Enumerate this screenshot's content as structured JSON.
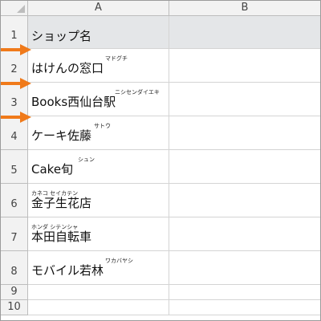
{
  "columns": [
    "A",
    "B"
  ],
  "rows": [
    {
      "num": "1",
      "text": "ショップ名",
      "furigana": "",
      "header": true,
      "arrow": false
    },
    {
      "num": "2",
      "text": "はけんの窓口",
      "furigana": "マドグチ",
      "header": false,
      "arrow": true
    },
    {
      "num": "3",
      "text": "Books西仙台駅",
      "furigana": "ニシセンダイエキ",
      "header": false,
      "arrow": true
    },
    {
      "num": "4",
      "text": "ケーキ佐藤",
      "furigana": "サトウ",
      "header": false,
      "arrow": true
    },
    {
      "num": "5",
      "text": "Cake旬",
      "furigana": "シュン",
      "header": false,
      "arrow": false
    },
    {
      "num": "6",
      "text": "金子生花店",
      "furigana": "カネコ セイカテン",
      "header": false,
      "arrow": false
    },
    {
      "num": "7",
      "text": "本田自転車",
      "furigana": "ホンダ シテンシャ",
      "header": false,
      "arrow": false
    },
    {
      "num": "8",
      "text": "モバイル若林",
      "furigana": "ワカバヤシ",
      "header": false,
      "arrow": false
    },
    {
      "num": "9",
      "text": "",
      "furigana": "",
      "header": false,
      "arrow": false
    },
    {
      "num": "10",
      "text": "",
      "furigana": "",
      "header": false,
      "arrow": false
    }
  ],
  "colors": {
    "arrow": "#f07a1a",
    "header_row": "#e4e6e8",
    "gridline": "#d4d4d4"
  }
}
